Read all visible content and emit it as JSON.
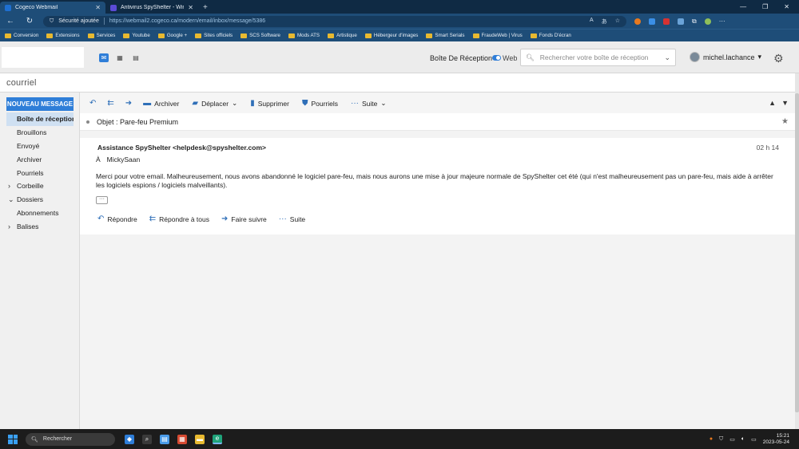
{
  "browser": {
    "tabs": [
      {
        "title": "Cogeco Webmail",
        "active": true,
        "color": "#1e6fd0"
      },
      {
        "title": "Antivirus SpyShelter - Windows",
        "active": false,
        "color": "#5b4bd6"
      }
    ],
    "new_tab": "+",
    "security_label": "Sécurité ajoutée",
    "url": "https://webmail2.cogeco.ca/modern/email/inbox/message/5386",
    "bookmarks": [
      "Conversion",
      "Extensions",
      "Services",
      "Youtube",
      "Google +",
      "Sites officiels",
      "SCS Software",
      "Mods ATS",
      "Artistique",
      "Hébergeur d'images",
      "Smart Serials",
      "FraudeWeb | Virus",
      "Fonds D'écran"
    ]
  },
  "header": {
    "inbox_label": "Boîte De Réception",
    "web_label": "Web",
    "search_placeholder": "Rechercher votre boîte de réception",
    "username": "michel.lachance",
    "app_title": "courriel"
  },
  "sidebar": {
    "new_message": "NOUVEAU MESSAGE",
    "items": [
      {
        "label": "Boîte de réception",
        "selected": true,
        "group": false,
        "caret": ""
      },
      {
        "label": "Brouillons",
        "selected": false,
        "group": false,
        "caret": ""
      },
      {
        "label": "Envoyé",
        "selected": false,
        "group": false,
        "caret": ""
      },
      {
        "label": "Archiver",
        "selected": false,
        "group": false,
        "caret": ""
      },
      {
        "label": "Pourriels",
        "selected": false,
        "group": false,
        "caret": ""
      },
      {
        "label": "Corbeille",
        "selected": false,
        "group": true,
        "caret": "›"
      },
      {
        "label": "Dossiers",
        "selected": false,
        "group": true,
        "caret": "⌄"
      },
      {
        "label": "Abonnements",
        "selected": false,
        "group": false,
        "caret": ""
      },
      {
        "label": "Balises",
        "selected": false,
        "group": true,
        "caret": "›"
      }
    ]
  },
  "toolbar": {
    "archive": "Archiver",
    "move": "Déplacer",
    "delete": "Supprimer",
    "spam": "Pourriels",
    "more": "Suite"
  },
  "message": {
    "subject": "Objet : Pare-feu Premium",
    "sender": "Assistance SpyShelter <helpdesk@spyshelter.com>",
    "time": "02 h 14",
    "to_label": "À",
    "to": "MickySaan",
    "body": "Merci pour votre email. Malheureusement, nous avons abandonné le logiciel pare-feu, mais nous aurons une mise à jour majeure normale de SpyShelter cet été (qui n'est malheureusement pas un pare-feu, mais aide à arrêter les logiciels espions / logiciels malveillants).",
    "more_dots": "···",
    "actions": {
      "reply": "Répondre",
      "reply_all": "Répondre à tous",
      "forward": "Faire suivre",
      "more": "Suite"
    }
  },
  "taskbar": {
    "search_label": "Rechercher",
    "time": "15:21",
    "date": "2023-05-24"
  },
  "colors": {
    "accent": "#2f7ed8",
    "browser_bar": "#1e4d78"
  }
}
